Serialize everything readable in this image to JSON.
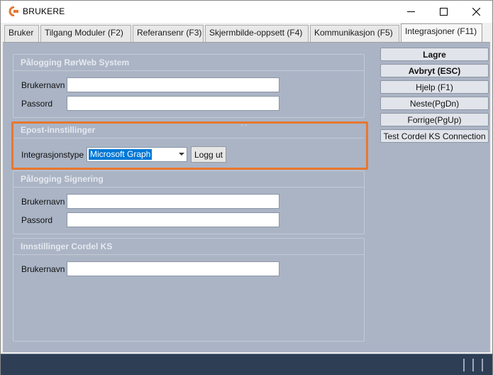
{
  "window": {
    "title": "BRUKERE",
    "controls": {
      "minimize_icon": "minimize-icon",
      "maximize_icon": "maximize-icon",
      "close_icon": "close-icon"
    }
  },
  "tabs": [
    {
      "label": "Bruker",
      "active": false
    },
    {
      "label": "Tilgang Moduler (F2)",
      "active": false
    },
    {
      "label": "Referansenr (F3)",
      "active": false
    },
    {
      "label": "Skjermbilde-oppsett (F4)",
      "active": false
    },
    {
      "label": "Kommunikasjon (F5)",
      "active": false
    },
    {
      "label": "Integrasjoner (F11)",
      "active": true
    }
  ],
  "groups": {
    "rorweb": {
      "title": "Pålogging RørWeb System",
      "username_label": "Brukernavn",
      "username_value": "",
      "password_label": "Passord",
      "password_value": ""
    },
    "epost": {
      "title": "Epost-innstillinger",
      "integration_label": "Integrasjonstype",
      "integration_value": "Microsoft Graph",
      "logout_label": "Logg ut"
    },
    "signering": {
      "title": "Pålogging Signering",
      "username_label": "Brukernavn",
      "username_value": "",
      "password_label": "Passord",
      "password_value": ""
    },
    "cordel": {
      "title": "Innstillinger Cordel KS",
      "username_label": "Brukernavn",
      "username_value": ""
    }
  },
  "side_buttons": {
    "save": "Lagre",
    "cancel": "Avbryt (ESC)",
    "help": "Hjelp (F1)",
    "next": "Neste(PgDn)",
    "previous": "Forrige(PgUp)",
    "test": "Test Cordel KS Connection"
  },
  "colors": {
    "content_bg": "#aab4c5",
    "highlight": "#e8772e",
    "selection": "#0078d7",
    "statusbar": "#2e3f55"
  }
}
